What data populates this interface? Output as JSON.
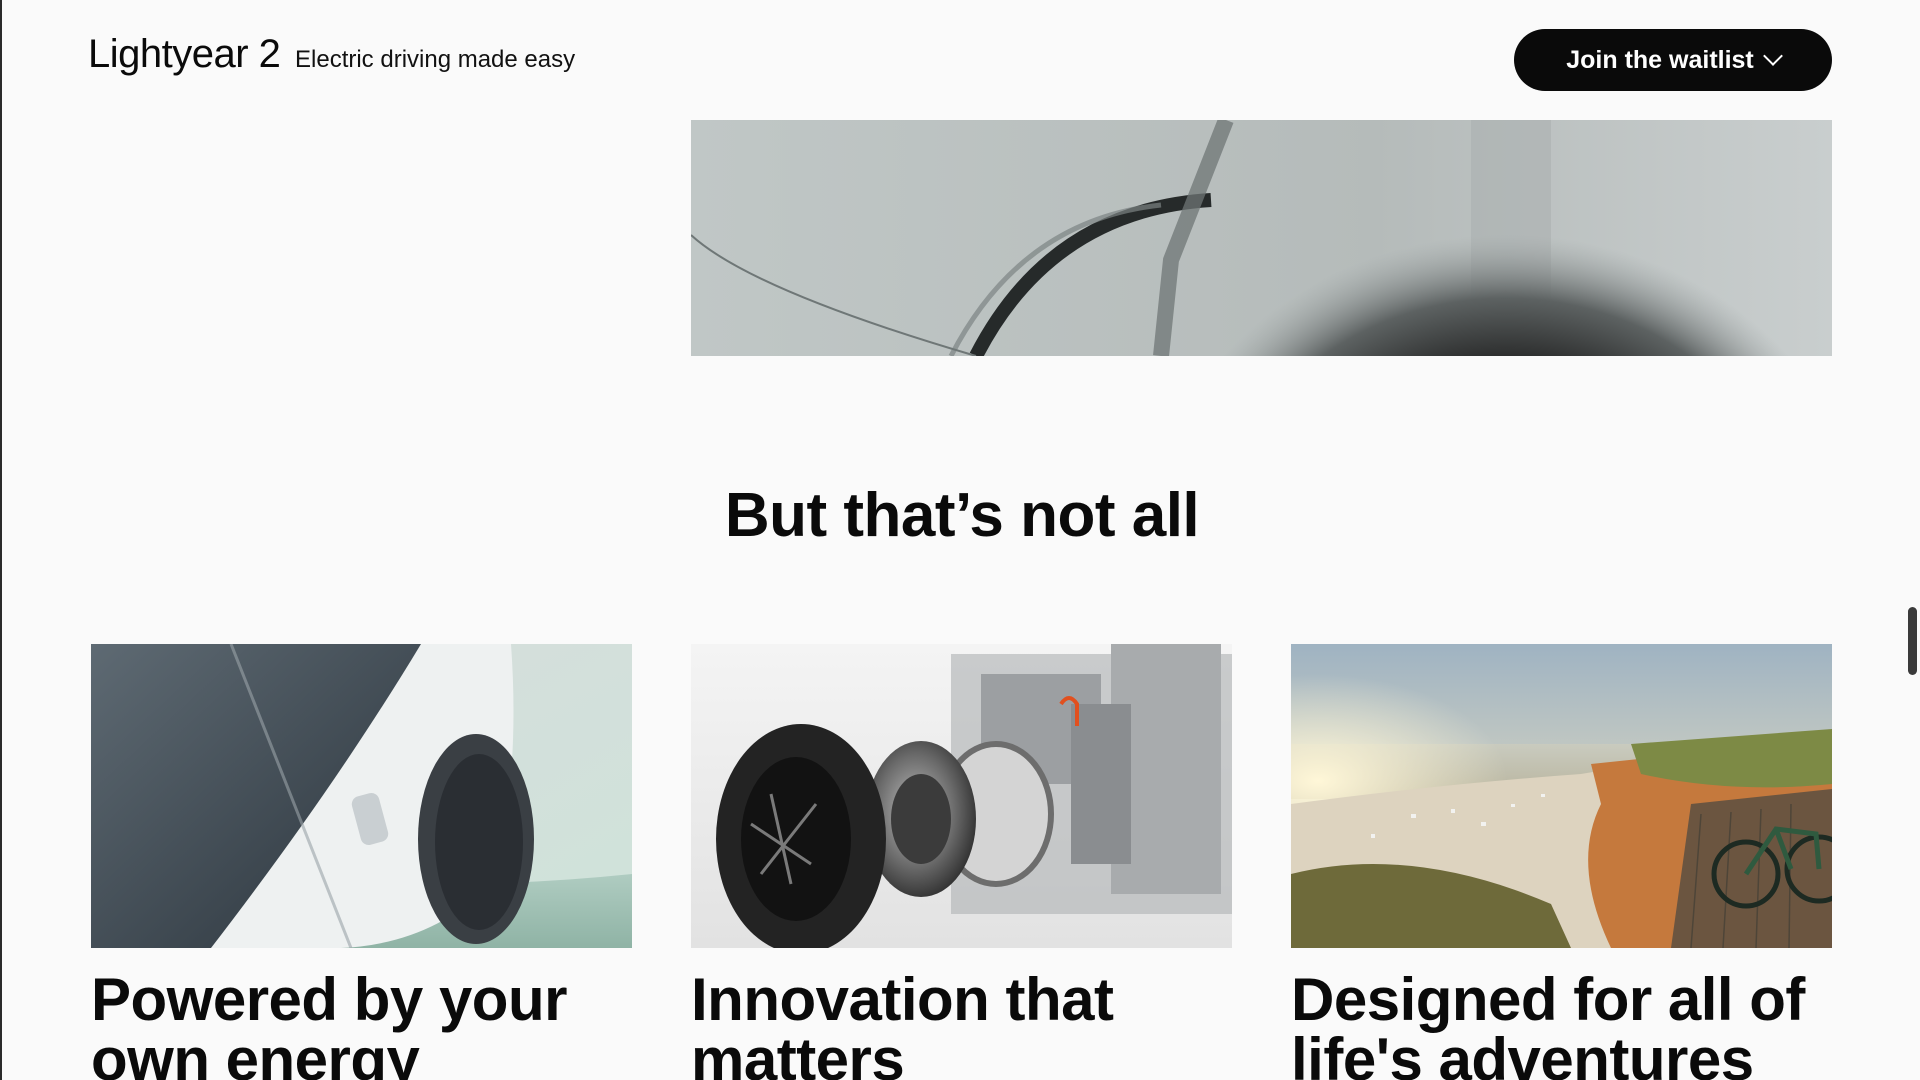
{
  "header": {
    "logo": "Lightyear 2",
    "tagline": "Electric driving made easy",
    "cta_label": "Join the waitlist"
  },
  "section": {
    "title": "But that’s not all"
  },
  "cards": [
    {
      "title": "Powered by your\nown energy",
      "image": "car-side-closeup"
    },
    {
      "title": "Innovation that\nmatters",
      "image": "in-wheel-motor-render"
    },
    {
      "title": "Designed for all of\nlife's adventures",
      "image": "beach-cliff-bicycle"
    }
  ],
  "colors": {
    "background": "#fafafa",
    "text": "#0a0a0a",
    "cta_background": "#0a0a0a",
    "cta_text": "#ffffff"
  },
  "icons": {
    "cta_chevron": "chevron-down-icon"
  }
}
